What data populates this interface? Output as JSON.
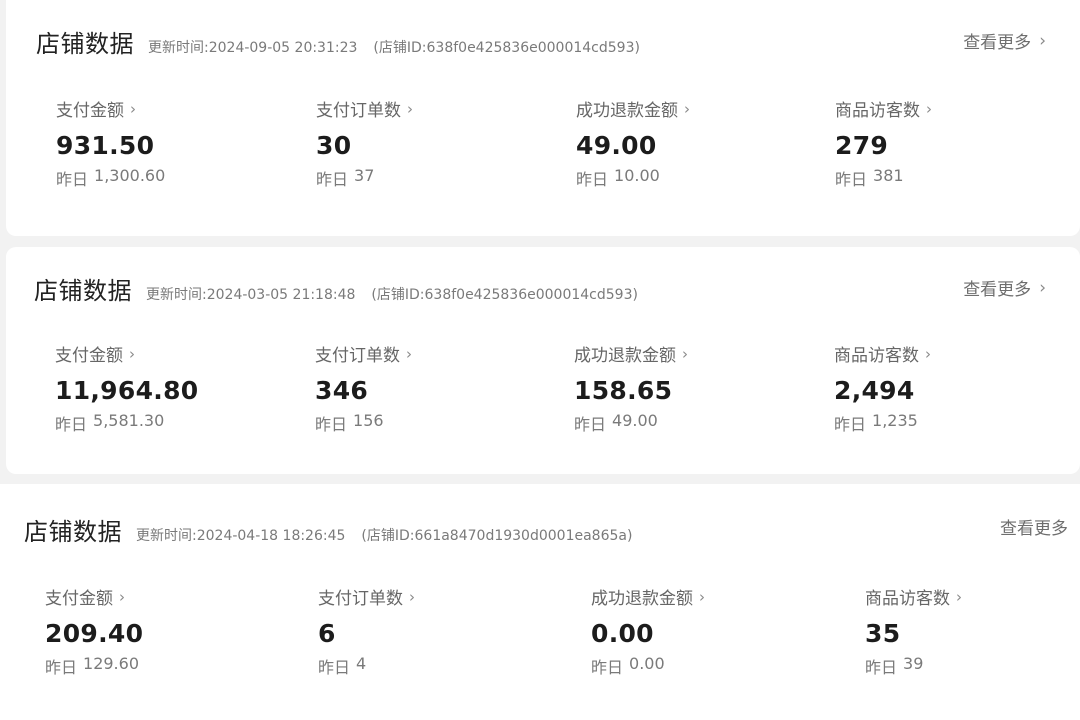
{
  "cards": [
    {
      "title": "店铺数据",
      "update_label": "更新时间:",
      "update_time": "2024-09-05 20:31:23",
      "shop_id_text": "(店铺ID:638f0e425836e000014cd593)",
      "more_label": "查看更多",
      "metrics": [
        {
          "label": "支付金额",
          "value": "931.50",
          "yesterday_label": "昨日",
          "yesterday_value": "1,300.60"
        },
        {
          "label": "支付订单数",
          "value": "30",
          "yesterday_label": "昨日",
          "yesterday_value": "37"
        },
        {
          "label": "成功退款金额",
          "value": "49.00",
          "yesterday_label": "昨日",
          "yesterday_value": "10.00"
        },
        {
          "label": "商品访客数",
          "value": "279",
          "yesterday_label": "昨日",
          "yesterday_value": "381"
        }
      ]
    },
    {
      "title": "店铺数据",
      "update_label": "更新时间:",
      "update_time": "2024-03-05 21:18:48",
      "shop_id_text": "(店铺ID:638f0e425836e000014cd593)",
      "more_label": "查看更多",
      "metrics": [
        {
          "label": "支付金额",
          "value": "11,964.80",
          "yesterday_label": "昨日",
          "yesterday_value": "5,581.30"
        },
        {
          "label": "支付订单数",
          "value": "346",
          "yesterday_label": "昨日",
          "yesterday_value": "156"
        },
        {
          "label": "成功退款金额",
          "value": "158.65",
          "yesterday_label": "昨日",
          "yesterday_value": "49.00"
        },
        {
          "label": "商品访客数",
          "value": "2,494",
          "yesterday_label": "昨日",
          "yesterday_value": "1,235"
        }
      ]
    },
    {
      "title": "店铺数据",
      "update_label": "更新时间:",
      "update_time": "2024-04-18 18:26:45",
      "shop_id_text": "(店铺ID:661a8470d1930d0001ea865a)",
      "more_label": "查看更多",
      "metrics": [
        {
          "label": "支付金额",
          "value": "209.40",
          "yesterday_label": "昨日",
          "yesterday_value": "129.60"
        },
        {
          "label": "支付订单数",
          "value": "6",
          "yesterday_label": "昨日",
          "yesterday_value": "4"
        },
        {
          "label": "成功退款金额",
          "value": "0.00",
          "yesterday_label": "昨日",
          "yesterday_value": "0.00"
        },
        {
          "label": "商品访客数",
          "value": "35",
          "yesterday_label": "昨日",
          "yesterday_value": "39"
        }
      ]
    }
  ],
  "icons": {
    "chevron": "chevron-right-icon",
    "chevron_glyph": "›"
  }
}
